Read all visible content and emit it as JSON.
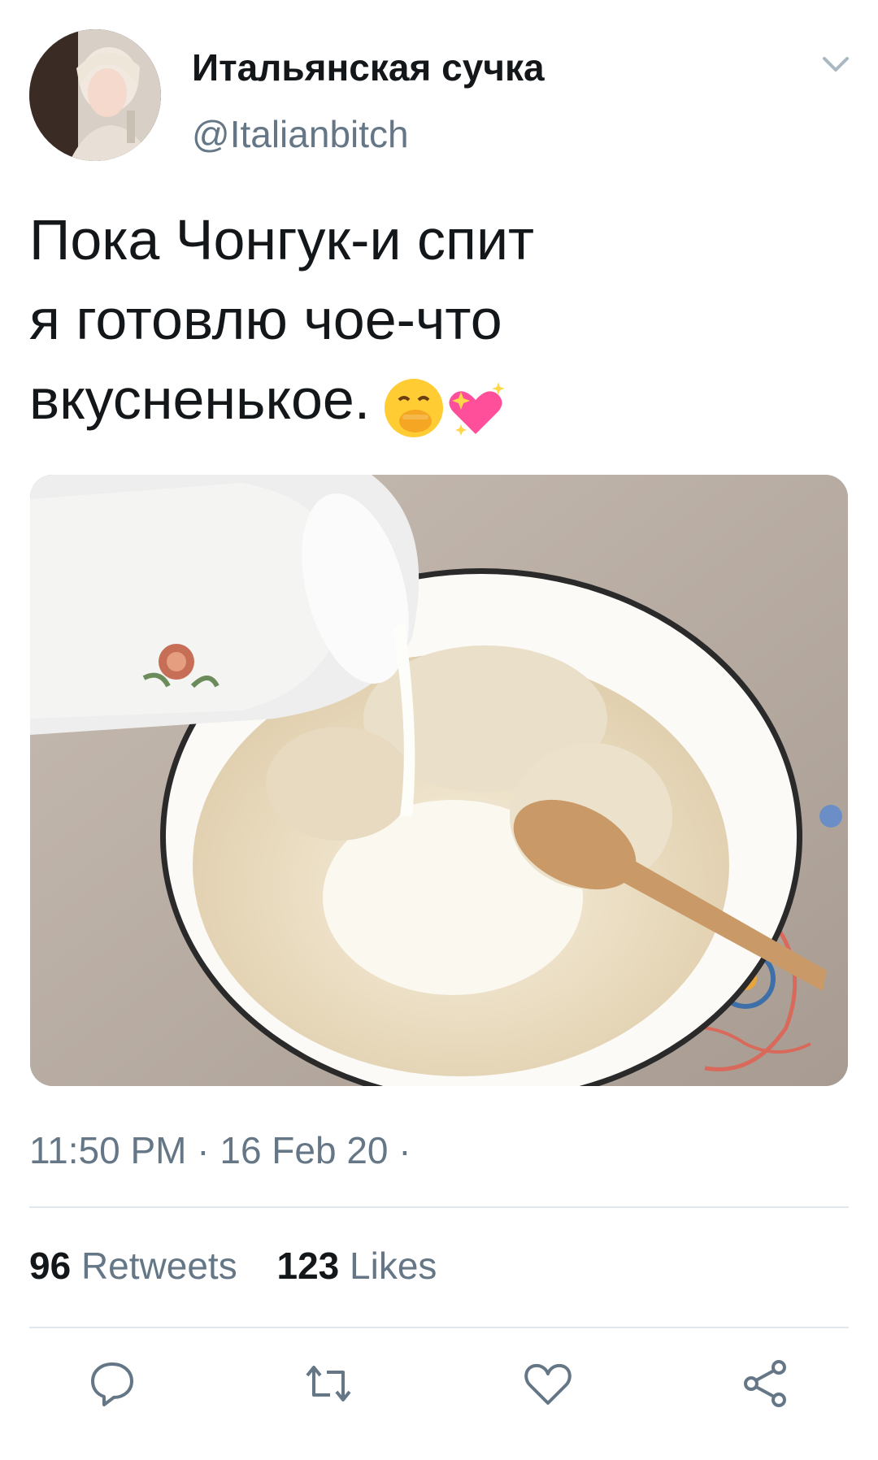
{
  "user": {
    "display_name": "Итальянская сучка",
    "handle": "@Italianbitch"
  },
  "tweet": {
    "text": "Пока Чонгук-и спит\nя готовлю чое-что\nвкусненькое.",
    "emojis": "🤭💖"
  },
  "meta": {
    "timestamp": "11:50 PM · 16 Feb 20 ·"
  },
  "stats": {
    "retweets_count": "96",
    "retweets_label": "Retweets",
    "likes_count": "123",
    "likes_label": "Likes"
  },
  "icons": {
    "more": "chevron-down-icon",
    "reply": "reply-icon",
    "retweet": "retweet-icon",
    "like": "heart-icon",
    "share": "share-icon"
  },
  "colors": {
    "text_primary": "#14171a",
    "text_secondary": "#657786",
    "divider": "#e1e8ed"
  }
}
